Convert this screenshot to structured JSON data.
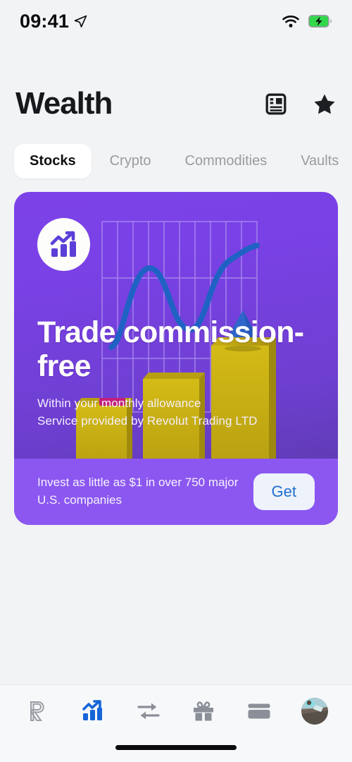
{
  "status_bar": {
    "time": "09:41",
    "location_icon": "location-arrow-icon",
    "wifi_icon": "wifi-icon",
    "battery_icon": "battery-charging-icon",
    "battery_color": "#32d74b"
  },
  "header": {
    "title": "Wealth",
    "actions": [
      {
        "name": "news-icon",
        "label": "News"
      },
      {
        "name": "star-icon",
        "label": "Favourites"
      }
    ]
  },
  "tabs": [
    {
      "label": "Stocks",
      "active": true
    },
    {
      "label": "Crypto",
      "active": false
    },
    {
      "label": "Commodities",
      "active": false
    },
    {
      "label": "Vaults",
      "active": false
    }
  ],
  "promo_card": {
    "badge_icon": "growth-chart-icon",
    "headline": "Trade commission-free",
    "sub_line_1": "Within your monthly allowance",
    "sub_line_2": "Service provided by Revolut Trading LTD",
    "footer_text": "Invest as little as $1 in over 750 major U.S. companies",
    "cta_label": "Get",
    "background_color": "#7a41e6",
    "footer_color": "#8b57f0",
    "accent_bar_color": "#c9b014",
    "accent_line_color": "#1f62c4",
    "cta_text_color": "#1d6fd0"
  },
  "bottom_nav": [
    {
      "name": "nav-home",
      "icon": "revolut-r-icon",
      "active": false
    },
    {
      "name": "nav-wealth",
      "icon": "stocks-chart-icon",
      "active": true
    },
    {
      "name": "nav-exchange",
      "icon": "exchange-arrows-icon",
      "active": false
    },
    {
      "name": "nav-rewards",
      "icon": "gift-icon",
      "active": false
    },
    {
      "name": "nav-cards",
      "icon": "card-icon",
      "active": false
    },
    {
      "name": "nav-profile",
      "icon": "avatar-icon",
      "active": false
    }
  ],
  "home_indicator": "home-indicator"
}
